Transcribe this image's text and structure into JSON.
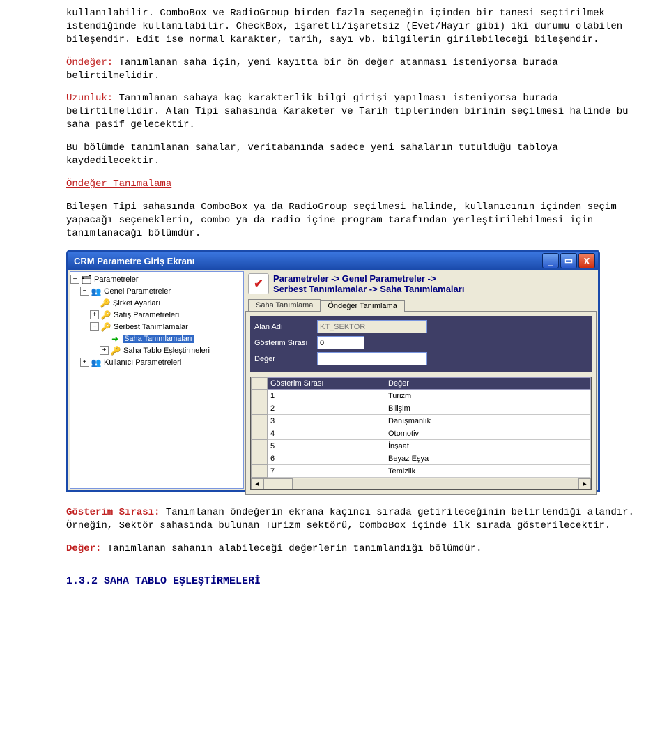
{
  "paragraphs": {
    "p1": "kullanılabilir. ComboBox ve RadioGroup birden fazla seçeneğin içinden bir tanesi seçtirilmek istendiğinde kullanılabilir. CheckBox, işaretli/işaretsiz (Evet/Hayır gibi) iki durumu olabilen bileşendir. Edit ise normal karakter, tarih, sayı vb. bilgilerin girilebileceği bileşendir.",
    "ondeger_kw": "Öndeğer:",
    "ondeger_txt": " Tanımlanan saha için, yeni kayıtta bir ön değer atanması isteniyorsa burada belirtilmelidir.",
    "uzunluk_kw": "Uzunluk:",
    "uzunluk_txt": " Tanımlanan sahaya kaç karakterlik bilgi girişi yapılması isteniyorsa burada belirtilmelidir. Alan Tipi sahasında Karaketer ve Tarih tiplerinden birinin seçilmesi halinde bu saha pasif gelecektir.",
    "p4": "Bu bölümde tanımlanan sahalar, veritabanında sadece yeni sahaların tutulduğu tabloya kaydedilecektir.",
    "link": "Öndeğer Tanımalama",
    "p5": "Bileşen Tipi sahasında ComboBox ya da RadioGroup seçilmesi halinde, kullanıcının içinden seçim yapacağı seçeneklerin, combo ya da radio içine program tarafından yerleştirilebilmesi için tanımlanacağı bölümdür.",
    "gosterim_kw": "Gösterim Sırası:",
    "gosterim_txt": " Tanımlanan öndeğerin ekrana kaçıncı sırada getirileceğinin belirlendiği alandır. Örneğin, Sektör sahasında bulunan Turizm sektörü, ComboBox içinde ilk sırada gösterilecektir.",
    "deger_kw": "Değer:",
    "deger_txt": " Tanımlanan sahanın alabileceği değerlerin tanımlandığı bölümdür.",
    "heading": "1.3.2 SAHA TABLO EŞLEŞTİRMELERİ"
  },
  "window": {
    "title": "CRM Parametre Giriş Ekranı",
    "min": "_",
    "max": "▭",
    "close": "X",
    "breadcrumb_l1": "Parametreler -> Genel Parametreler ->",
    "breadcrumb_l2": "Serbest Tanımlamalar -> Saha Tanımlamaları",
    "tree": {
      "n0": "Parametreler",
      "n1": "Genel Parametreler",
      "n2": "Şirket Ayarları",
      "n3": "Satış Parametreleri",
      "n4": "Serbest Tanımlamalar",
      "n5": "Saha Tanımlamaları",
      "n6": "Saha Tablo Eşleştirmeleri",
      "n7": "Kullanıcı Parametreleri"
    },
    "tabs": {
      "t1": "Saha Tanımlama",
      "t2": "Öndeğer Tanımlama"
    },
    "form": {
      "alan_adi_lbl": "Alan Adı",
      "alan_adi_val": "KT_SEKTOR",
      "gosterim_lbl": "Gösterim Sırası",
      "gosterim_val": "0",
      "deger_lbl": "Değer"
    },
    "grid": {
      "col1": "Gösterim Sırası",
      "col2": "Değer",
      "rows": [
        {
          "c1": "1",
          "c2": "Turizm"
        },
        {
          "c1": "2",
          "c2": "Bilişim"
        },
        {
          "c1": "3",
          "c2": "Danışmanlık"
        },
        {
          "c1": "4",
          "c2": "Otomotiv"
        },
        {
          "c1": "5",
          "c2": "İnşaat"
        },
        {
          "c1": "6",
          "c2": "Beyaz Eşya"
        },
        {
          "c1": "7",
          "c2": "Temizlik"
        }
      ]
    }
  }
}
